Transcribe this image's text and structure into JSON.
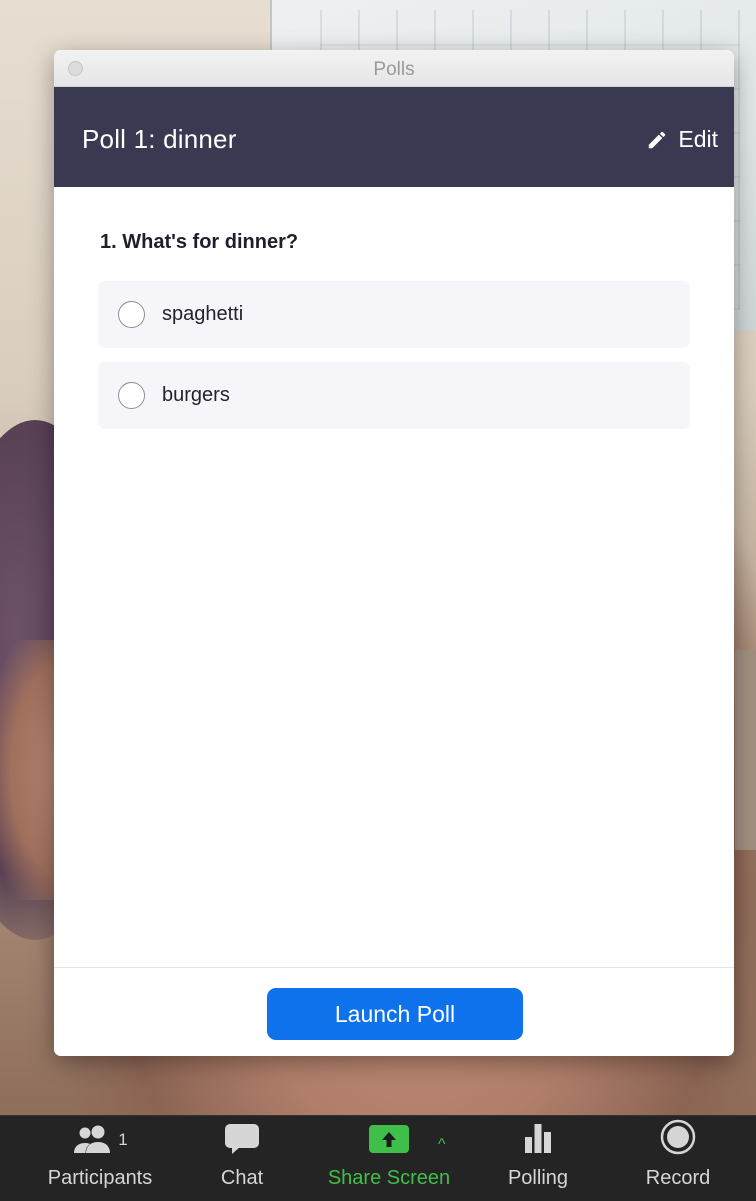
{
  "window": {
    "title": "Polls"
  },
  "poll": {
    "title": "Poll 1: dinner",
    "edit_label": "Edit",
    "question": "1. What's for dinner?",
    "options": [
      {
        "label": "spaghetti",
        "selected": false
      },
      {
        "label": "burgers",
        "selected": false
      }
    ],
    "launch_label": "Launch Poll"
  },
  "toolbar": {
    "participants": {
      "label": "Participants",
      "count": "1",
      "icon": "participants-icon"
    },
    "chat": {
      "label": "Chat",
      "icon": "chat-bubble-icon"
    },
    "share_screen": {
      "label": "Share Screen",
      "icon": "share-screen-icon",
      "caret": "^"
    },
    "polling": {
      "label": "Polling",
      "icon": "bar-chart-icon"
    },
    "record": {
      "label": "Record",
      "icon": "record-icon"
    }
  },
  "colors": {
    "header_bg": "#393951",
    "launch_button": "#0e72ed",
    "toolbar_bg": "#242424",
    "share_green": "#3fbf4a"
  }
}
